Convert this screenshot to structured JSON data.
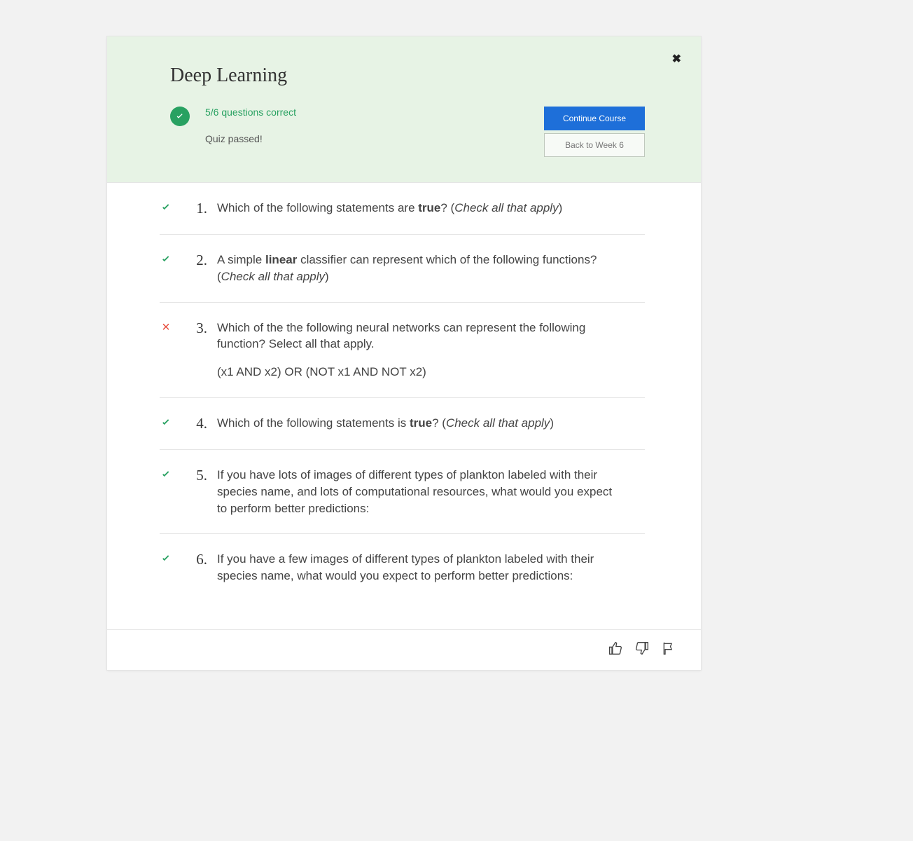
{
  "title": "Deep Learning",
  "score_text": "5/6 questions correct",
  "passed_text": "Quiz passed!",
  "buttons": {
    "continue": "Continue Course",
    "back": "Back to Week 6"
  },
  "questions": [
    {
      "num": "1.",
      "correct": true,
      "html": "Which of the following statements are <strong>true</strong>? (<em>Check all that apply</em>)"
    },
    {
      "num": "2.",
      "correct": true,
      "html": "A simple <strong>linear</strong> classifier can represent which of the following functions? (<em>Check all that apply</em>)"
    },
    {
      "num": "3.",
      "correct": false,
      "html": "Which of the the following neural networks can represent the following function? Select all that apply.",
      "extra": "(x1 AND x2) OR (NOT x1 AND NOT x2)"
    },
    {
      "num": "4.",
      "correct": true,
      "html": "Which of the following statements is <strong>true</strong>? (<em>Check all that apply</em>)"
    },
    {
      "num": "5.",
      "correct": true,
      "html": "If you have lots of images of different types of plankton labeled with their species name, and lots of computational resources, what would you expect to perform better predictions:"
    },
    {
      "num": "6.",
      "correct": true,
      "html": "If you have a few images of different types of plankton labeled with their species name, what would you expect to perform better predictions:"
    }
  ]
}
